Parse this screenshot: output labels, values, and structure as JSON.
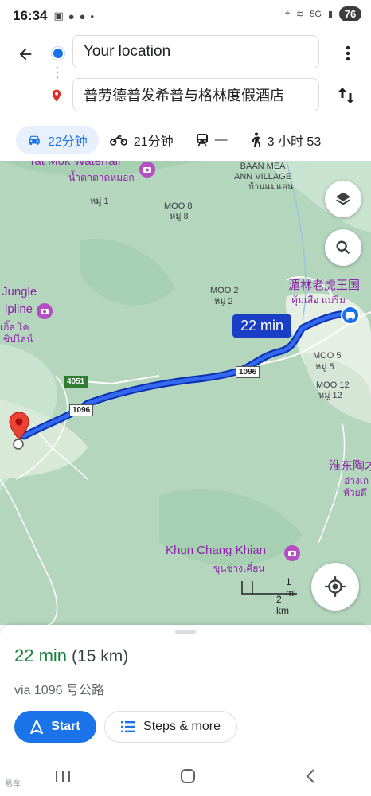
{
  "status_bar": {
    "time": "16:34",
    "network_label": "5G",
    "battery": "76"
  },
  "search": {
    "origin": "Your location",
    "destination": "普劳德普发希普与格林度假酒店"
  },
  "travel_modes": [
    {
      "mode": "car-icon",
      "label": "22分钟"
    },
    {
      "mode": "motorcycle-icon",
      "label": "21分钟"
    },
    {
      "mode": "transit-icon",
      "label": "—"
    },
    {
      "mode": "walk-icon",
      "label": "3 小时 53"
    }
  ],
  "map": {
    "labels": {
      "tat_mok": "Tat Mok Waterfall",
      "tat_mok_th": "น้ำตกตาดหมอก",
      "baan_mea": "BAAN MEA\nANN VILLAGE",
      "baan_mea_th": "บ้านแม่แอน",
      "moo1_th": "หมู่ 1",
      "moo8": "MOO 8",
      "moo8_th": "หมู่ 8",
      "moo2": "MOO 2",
      "moo2_th": "หมู่ 2",
      "moo5": "MOO 5",
      "moo5_th": "หมู่ 5",
      "moo12": "MOO 12",
      "moo12_th": "หมู่ 12",
      "jungle": "Jungle",
      "zipline": "ipline",
      "jungle_th_1": "เกิ้ล โค",
      "jungle_th_2": "ซิปไลน์",
      "tiger_kingdom": "湄林老虎王国",
      "tiger_kingdom_th": "คุ้มเสือ แม่ริม",
      "huai_tung": "淮东陶才",
      "huai_tung_th_1": "อ่างเก",
      "huai_tung_th_2": "ห้วยตึ",
      "khun_chang": "Khun Chang Khian",
      "khun_chang_th": "ขุนช่างเคี่ยน"
    },
    "road_shields": {
      "r4051": "4051",
      "r1096_a": "1096",
      "r1096_b": "1096"
    },
    "route_callout": "22 min",
    "scale": {
      "mi": "1 mi",
      "km": "2 km"
    }
  },
  "sheet": {
    "eta": "22 min",
    "distance": "(15 km)",
    "via": "via 1096 号公路",
    "start_label": "Start",
    "steps_label": "Steps & more"
  },
  "watermark": "易车"
}
